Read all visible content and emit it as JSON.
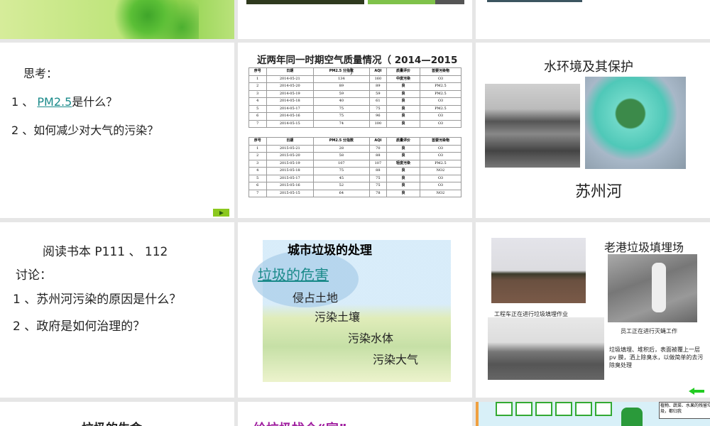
{
  "slides": {
    "think": {
      "title": "思考：",
      "q1_prefix": "1 、",
      "q1_link": "PM2.5",
      "q1_suffix": "是什么？",
      "q2": "2 、如何减少对大气的污染？"
    },
    "air_quality": {
      "title": "近两年同一时期空气质量情况（ 2014—2015",
      "paren": "）",
      "headers": [
        "序号",
        "日期",
        "PM2.5 分指数",
        "AQI",
        "质量评价",
        "首要污染物"
      ],
      "rows_2014": [
        [
          "1",
          "2014-05-21",
          "134",
          "160",
          "中度污染",
          "O3"
        ],
        [
          "2",
          "2014-05-20",
          "89",
          "89",
          "良",
          "PM2.5"
        ],
        [
          "3",
          "2014-05-19",
          "59",
          "59",
          "良",
          "PM2.5"
        ],
        [
          "4",
          "2014-05-18",
          "40",
          "61",
          "良",
          "O3"
        ],
        [
          "5",
          "2014-05-17",
          "75",
          "75",
          "良",
          "PM2.5"
        ],
        [
          "6",
          "2014-05-16",
          "75",
          "96",
          "良",
          "O3"
        ],
        [
          "7",
          "2014-05-15",
          "74",
          "100",
          "良",
          "O3"
        ]
      ],
      "rows_2015": [
        [
          "1",
          "2015-05-21",
          "28",
          "70",
          "良",
          "O3"
        ],
        [
          "2",
          "2015-05-20",
          "58",
          "88",
          "良",
          "O3"
        ],
        [
          "3",
          "2015-05-19",
          "107",
          "107",
          "轻度污染",
          "PM2.5"
        ],
        [
          "4",
          "2015-05-18",
          "75",
          "88",
          "良",
          "NO2"
        ],
        [
          "5",
          "2015-05-17",
          "45",
          "75",
          "良",
          "O3"
        ],
        [
          "6",
          "2015-05-16",
          "52",
          "75",
          "良",
          "O3"
        ],
        [
          "7",
          "2015-05-15",
          "64",
          "78",
          "良",
          "NO2"
        ]
      ]
    },
    "water": {
      "title": "水环境及其保护",
      "caption": "苏州河"
    },
    "reading": {
      "line1": "阅读书本 P111 、 112",
      "line2": "讨论：",
      "q1": "1 、苏州河污染的原因是什么？",
      "q2": "2 、政府是如何治理的？"
    },
    "garbage": {
      "title": "城市垃圾的处理",
      "link": "垃圾的危害",
      "items": [
        "侵占土地",
        "污染土壤",
        "污染水体",
        "污染大气"
      ]
    },
    "landfill": {
      "title": "老港垃圾填埋场",
      "caption1": "工程车正在进行垃圾填埋作业",
      "caption2": "员工正在进行灭蝇工作",
      "desc": "垃圾填埋、堆积后，表面被覆上一层 pv 膜，洒上除臭水，以做简单的去污除臭处理"
    },
    "life": {
      "title": "垃圾的生命"
    },
    "home": {
      "title": "给垃圾找个“家”"
    },
    "sorting": {
      "bubble": "植物、蔬菜、水果的残留垃圾，都归我"
    }
  },
  "colors": {
    "link": "#1a8a8a",
    "nav_green": "#8bc81e",
    "purple": "#a020a0"
  }
}
